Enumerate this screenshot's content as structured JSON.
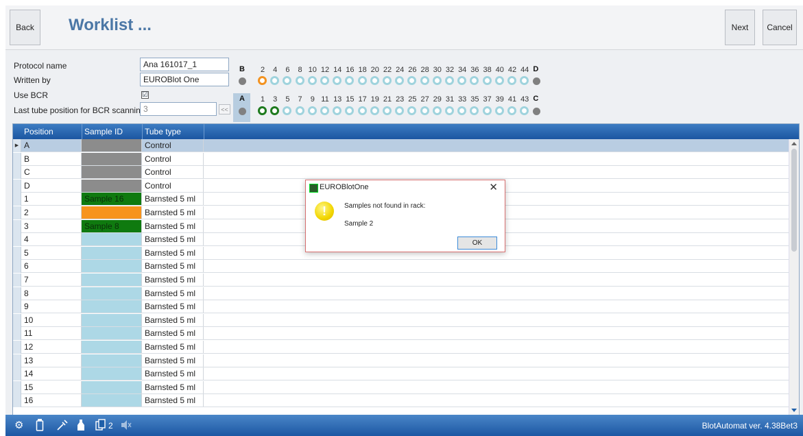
{
  "header": {
    "back_label": "Back",
    "title": "Worklist ...",
    "next_label": "Next",
    "cancel_label": "Cancel"
  },
  "protocol": {
    "protocol_name_label": "Protocol name",
    "protocol_name_value": "Ana 161017_1",
    "written_by_label": "Written by",
    "written_by_value": "EUROBlot One",
    "use_bcr_label": "Use BCR",
    "use_bcr_checked": "☑",
    "last_tube_label": "Last tube position for BCR scanning",
    "last_tube_value": "3",
    "last_tube_button": "<<"
  },
  "rack": {
    "top_letters": {
      "left": "B",
      "right": "D"
    },
    "bottom_letters": {
      "left": "A",
      "right": "C"
    },
    "top_numbers": [
      "2",
      "4",
      "6",
      "8",
      "10",
      "12",
      "14",
      "16",
      "18",
      "20",
      "22",
      "24",
      "26",
      "28",
      "30",
      "32",
      "34",
      "36",
      "38",
      "40",
      "42",
      "44"
    ],
    "bottom_numbers": [
      "1",
      "3",
      "5",
      "7",
      "9",
      "11",
      "13",
      "15",
      "17",
      "19",
      "21",
      "23",
      "25",
      "27",
      "29",
      "31",
      "33",
      "35",
      "37",
      "39",
      "41",
      "43"
    ]
  },
  "grid": {
    "columns": [
      "Position",
      "Sample ID",
      "Tube type"
    ],
    "rows": [
      {
        "position": "A",
        "sample_id": "",
        "tube": "Control",
        "color": "#8c8c8c"
      },
      {
        "position": "B",
        "sample_id": "",
        "tube": "Control",
        "color": "#8c8c8c"
      },
      {
        "position": "C",
        "sample_id": "",
        "tube": "Control",
        "color": "#8c8c8c"
      },
      {
        "position": "D",
        "sample_id": "",
        "tube": "Control",
        "color": "#8c8c8c"
      },
      {
        "position": "1",
        "sample_id": "Sample 16",
        "tube": "Barnsted 5 ml",
        "color": "#0f7a0f"
      },
      {
        "position": "2",
        "sample_id": "",
        "tube": "Barnsted 5 ml",
        "color": "#f7941d"
      },
      {
        "position": "3",
        "sample_id": "Sample 8",
        "tube": "Barnsted 5 ml",
        "color": "#0f7a0f"
      },
      {
        "position": "4",
        "sample_id": "",
        "tube": "Barnsted 5 ml",
        "color": "#add8e6"
      },
      {
        "position": "5",
        "sample_id": "",
        "tube": "Barnsted 5 ml",
        "color": "#add8e6"
      },
      {
        "position": "6",
        "sample_id": "",
        "tube": "Barnsted 5 ml",
        "color": "#add8e6"
      },
      {
        "position": "7",
        "sample_id": "",
        "tube": "Barnsted 5 ml",
        "color": "#add8e6"
      },
      {
        "position": "8",
        "sample_id": "",
        "tube": "Barnsted 5 ml",
        "color": "#add8e6"
      },
      {
        "position": "9",
        "sample_id": "",
        "tube": "Barnsted 5 ml",
        "color": "#add8e6"
      },
      {
        "position": "10",
        "sample_id": "",
        "tube": "Barnsted 5 ml",
        "color": "#add8e6"
      },
      {
        "position": "11",
        "sample_id": "",
        "tube": "Barnsted 5 ml",
        "color": "#add8e6"
      },
      {
        "position": "12",
        "sample_id": "",
        "tube": "Barnsted 5 ml",
        "color": "#add8e6"
      },
      {
        "position": "13",
        "sample_id": "",
        "tube": "Barnsted 5 ml",
        "color": "#add8e6"
      },
      {
        "position": "14",
        "sample_id": "",
        "tube": "Barnsted 5 ml",
        "color": "#add8e6"
      },
      {
        "position": "15",
        "sample_id": "",
        "tube": "Barnsted 5 ml",
        "color": "#add8e6"
      },
      {
        "position": "16",
        "sample_id": "",
        "tube": "Barnsted 5 ml",
        "color": "#add8e6"
      }
    ]
  },
  "dialog": {
    "title": "EUROBlotOne",
    "message": "Samples not found in rack:",
    "detail": "Sample 2",
    "ok_label": "OK",
    "close_glyph": "✕"
  },
  "statusbar": {
    "icons": [
      "gear-icon",
      "tube-icon",
      "pipette-icon",
      "bottle-icon",
      "copy-icon",
      "speaker-muted-icon"
    ],
    "copy_count": "2",
    "version": "BlotAutomat ver. 4.38Bet3"
  }
}
